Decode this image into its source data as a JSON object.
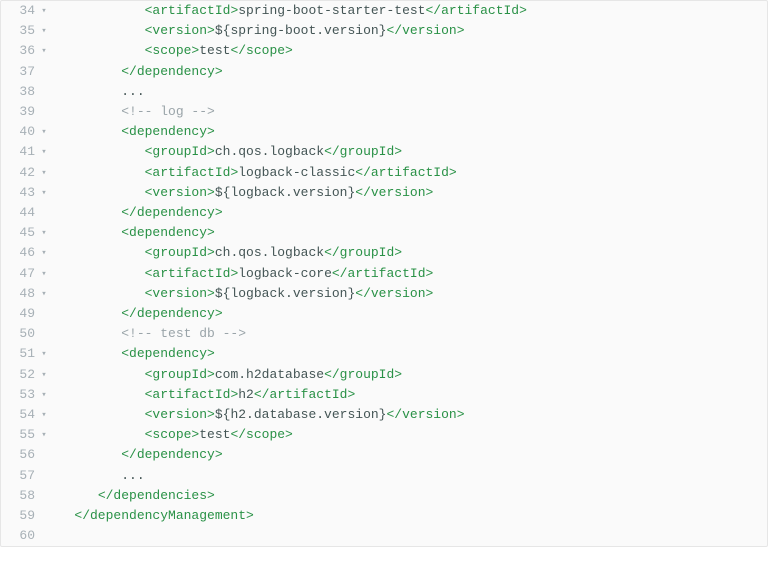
{
  "indent": "   ",
  "lines": [
    {
      "n": 34,
      "fold": true,
      "indent": 4,
      "tokens": [
        {
          "c": "tag",
          "t": "<artifactId>"
        },
        {
          "c": "txt",
          "t": "spring-boot-starter-test"
        },
        {
          "c": "tag",
          "t": "</artifactId>"
        }
      ]
    },
    {
      "n": 35,
      "fold": true,
      "indent": 4,
      "tokens": [
        {
          "c": "tag",
          "t": "<version>"
        },
        {
          "c": "ph",
          "t": "${spring-boot.version}"
        },
        {
          "c": "tag",
          "t": "</version>"
        }
      ]
    },
    {
      "n": 36,
      "fold": true,
      "indent": 4,
      "tokens": [
        {
          "c": "tag",
          "t": "<scope>"
        },
        {
          "c": "txt",
          "t": "test"
        },
        {
          "c": "tag",
          "t": "</scope>"
        }
      ]
    },
    {
      "n": 37,
      "fold": false,
      "indent": 3,
      "tokens": [
        {
          "c": "tag",
          "t": "</dependency>"
        }
      ]
    },
    {
      "n": 38,
      "fold": false,
      "indent": 3,
      "tokens": [
        {
          "c": "txt",
          "t": "..."
        }
      ]
    },
    {
      "n": 39,
      "fold": false,
      "indent": 3,
      "tokens": [
        {
          "c": "cmt",
          "t": "<!-- log -->"
        }
      ]
    },
    {
      "n": 40,
      "fold": true,
      "indent": 3,
      "tokens": [
        {
          "c": "tag",
          "t": "<dependency>"
        }
      ]
    },
    {
      "n": 41,
      "fold": true,
      "indent": 4,
      "tokens": [
        {
          "c": "tag",
          "t": "<groupId>"
        },
        {
          "c": "txt",
          "t": "ch.qos.logback"
        },
        {
          "c": "tag",
          "t": "</groupId>"
        }
      ]
    },
    {
      "n": 42,
      "fold": true,
      "indent": 4,
      "tokens": [
        {
          "c": "tag",
          "t": "<artifactId>"
        },
        {
          "c": "txt",
          "t": "logback-classic"
        },
        {
          "c": "tag",
          "t": "</artifactId>"
        }
      ]
    },
    {
      "n": 43,
      "fold": true,
      "indent": 4,
      "tokens": [
        {
          "c": "tag",
          "t": "<version>"
        },
        {
          "c": "ph",
          "t": "${logback.version}"
        },
        {
          "c": "tag",
          "t": "</version>"
        }
      ]
    },
    {
      "n": 44,
      "fold": false,
      "indent": 3,
      "tokens": [
        {
          "c": "tag",
          "t": "</dependency>"
        }
      ]
    },
    {
      "n": 45,
      "fold": true,
      "indent": 3,
      "tokens": [
        {
          "c": "tag",
          "t": "<dependency>"
        }
      ]
    },
    {
      "n": 46,
      "fold": true,
      "indent": 4,
      "tokens": [
        {
          "c": "tag",
          "t": "<groupId>"
        },
        {
          "c": "txt",
          "t": "ch.qos.logback"
        },
        {
          "c": "tag",
          "t": "</groupId>"
        }
      ]
    },
    {
      "n": 47,
      "fold": true,
      "indent": 4,
      "tokens": [
        {
          "c": "tag",
          "t": "<artifactId>"
        },
        {
          "c": "txt",
          "t": "logback-core"
        },
        {
          "c": "tag",
          "t": "</artifactId>"
        }
      ]
    },
    {
      "n": 48,
      "fold": true,
      "indent": 4,
      "tokens": [
        {
          "c": "tag",
          "t": "<version>"
        },
        {
          "c": "ph",
          "t": "${logback.version}"
        },
        {
          "c": "tag",
          "t": "</version>"
        }
      ]
    },
    {
      "n": 49,
      "fold": false,
      "indent": 3,
      "tokens": [
        {
          "c": "tag",
          "t": "</dependency>"
        }
      ]
    },
    {
      "n": 50,
      "fold": false,
      "indent": 3,
      "tokens": [
        {
          "c": "cmt",
          "t": "<!-- test db -->"
        }
      ]
    },
    {
      "n": 51,
      "fold": true,
      "indent": 3,
      "tokens": [
        {
          "c": "tag",
          "t": "<dependency>"
        }
      ]
    },
    {
      "n": 52,
      "fold": true,
      "indent": 4,
      "tokens": [
        {
          "c": "tag",
          "t": "<groupId>"
        },
        {
          "c": "txt",
          "t": "com.h2database"
        },
        {
          "c": "tag",
          "t": "</groupId>"
        }
      ]
    },
    {
      "n": 53,
      "fold": true,
      "indent": 4,
      "tokens": [
        {
          "c": "tag",
          "t": "<artifactId>"
        },
        {
          "c": "txt",
          "t": "h2"
        },
        {
          "c": "tag",
          "t": "</artifactId>"
        }
      ]
    },
    {
      "n": 54,
      "fold": true,
      "indent": 4,
      "tokens": [
        {
          "c": "tag",
          "t": "<version>"
        },
        {
          "c": "ph",
          "t": "${h2.database.version}"
        },
        {
          "c": "tag",
          "t": "</version>"
        }
      ]
    },
    {
      "n": 55,
      "fold": true,
      "indent": 4,
      "tokens": [
        {
          "c": "tag",
          "t": "<scope>"
        },
        {
          "c": "txt",
          "t": "test"
        },
        {
          "c": "tag",
          "t": "</scope>"
        }
      ]
    },
    {
      "n": 56,
      "fold": false,
      "indent": 3,
      "tokens": [
        {
          "c": "tag",
          "t": "</dependency>"
        }
      ]
    },
    {
      "n": 57,
      "fold": false,
      "indent": 3,
      "tokens": [
        {
          "c": "txt",
          "t": "..."
        }
      ]
    },
    {
      "n": 58,
      "fold": false,
      "indent": 2,
      "tokens": [
        {
          "c": "tag",
          "t": "</dependencies>"
        }
      ]
    },
    {
      "n": 59,
      "fold": false,
      "indent": 1,
      "tokens": [
        {
          "c": "tag",
          "t": "</dependencyManagement>"
        }
      ]
    },
    {
      "n": 60,
      "fold": false,
      "indent": 0,
      "tokens": []
    }
  ]
}
